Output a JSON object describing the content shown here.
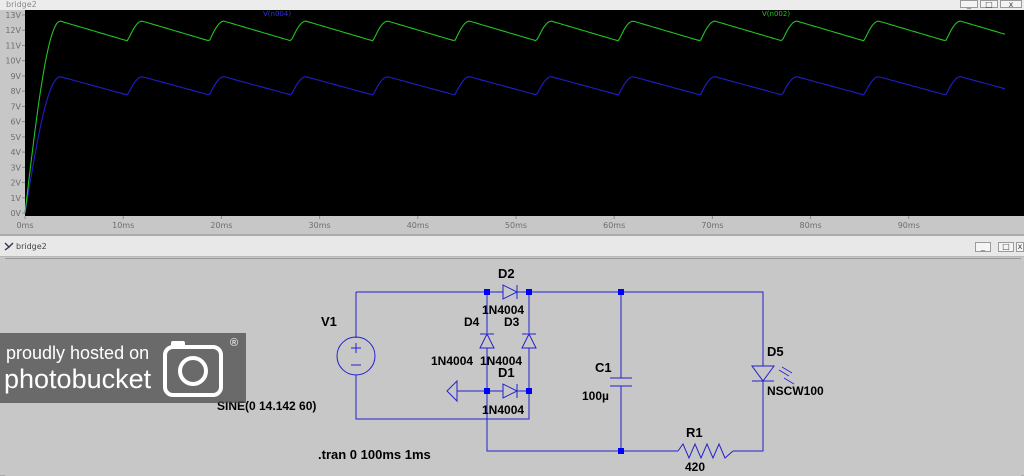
{
  "plot_window": {
    "title": "bridge2",
    "btn_min": "_",
    "btn_max": "□",
    "btn_close": "x"
  },
  "schematic_window": {
    "title": "bridge2",
    "btn_min": "_",
    "btn_max": "□",
    "btn_close": "x"
  },
  "chart_data": {
    "type": "line",
    "title": "",
    "xlabel": "",
    "ylabel": "",
    "xlim": [
      0,
      100
    ],
    "ylim": [
      0,
      13
    ],
    "x_ticks": [
      "0ms",
      "10ms",
      "20ms",
      "30ms",
      "40ms",
      "50ms",
      "60ms",
      "70ms",
      "80ms",
      "90ms"
    ],
    "y_ticks": [
      "0V",
      "1V",
      "2V",
      "3V",
      "4V",
      "5V",
      "6V",
      "7V",
      "8V",
      "9V",
      "10V",
      "11V",
      "12V",
      "13V"
    ],
    "grid": false,
    "legend": "top",
    "series": [
      {
        "name": "V(n004)",
        "color": "#1e1ecc",
        "x": [
          0,
          0.4,
          1,
          2,
          3,
          3.6,
          4.5,
          5.8,
          7.4,
          9.2,
          11,
          12.3,
          20.3,
          28.6,
          36.9,
          45.2,
          53.5,
          61.8,
          70.1,
          78.4,
          86.7,
          95,
          100
        ],
        "y": [
          0,
          1.8,
          4.8,
          7.5,
          8.6,
          8.95,
          8.9,
          8.7,
          8.4,
          8.05,
          7.75,
          8.95,
          8.95,
          8.95,
          8.95,
          8.95,
          8.95,
          8.95,
          8.95,
          8.95,
          8.95,
          8.95,
          8.15
        ]
      },
      {
        "name": "V(n002)",
        "color": "#22c322",
        "x": [
          0,
          0.4,
          1,
          2,
          3,
          3.6,
          4.5,
          5.8,
          7.4,
          9.2,
          11,
          12.3,
          20.3,
          28.6,
          36.9,
          45.2,
          53.5,
          61.8,
          70.1,
          78.4,
          86.7,
          95,
          100
        ],
        "y": [
          0,
          2.6,
          7.2,
          10.8,
          12.2,
          12.6,
          12.55,
          12.3,
          12,
          11.6,
          11.3,
          12.6,
          12.6,
          12.6,
          12.6,
          12.6,
          12.6,
          12.6,
          12.6,
          12.6,
          12.6,
          12.6,
          11.8
        ]
      }
    ]
  },
  "schematic": {
    "v1_name": "V1",
    "v1_value": "SINE(0 14.142 60)",
    "d1_name": "D1",
    "d1_model": "1N4004",
    "d2_name": "D2",
    "d2_model": "1N4004",
    "d3_name": "D3",
    "d3_model": "1N4004",
    "d4_name": "D4",
    "d4_model": "1N4004",
    "c1_name": "C1",
    "c1_value": "100µ",
    "d5_name": "D5",
    "d5_model": "NSCW100",
    "r1_name": "R1",
    "r1_value": "420",
    "directive": ".tran 0 100ms 1ms"
  },
  "watermark": {
    "line1": "proudly hosted on",
    "line2": "photobucket",
    "mark": "®"
  },
  "colors": {
    "wire": "#2222cc",
    "node": "#0000ff",
    "plot_bg": "#000000",
    "axis_text": "#8c8c8c"
  }
}
